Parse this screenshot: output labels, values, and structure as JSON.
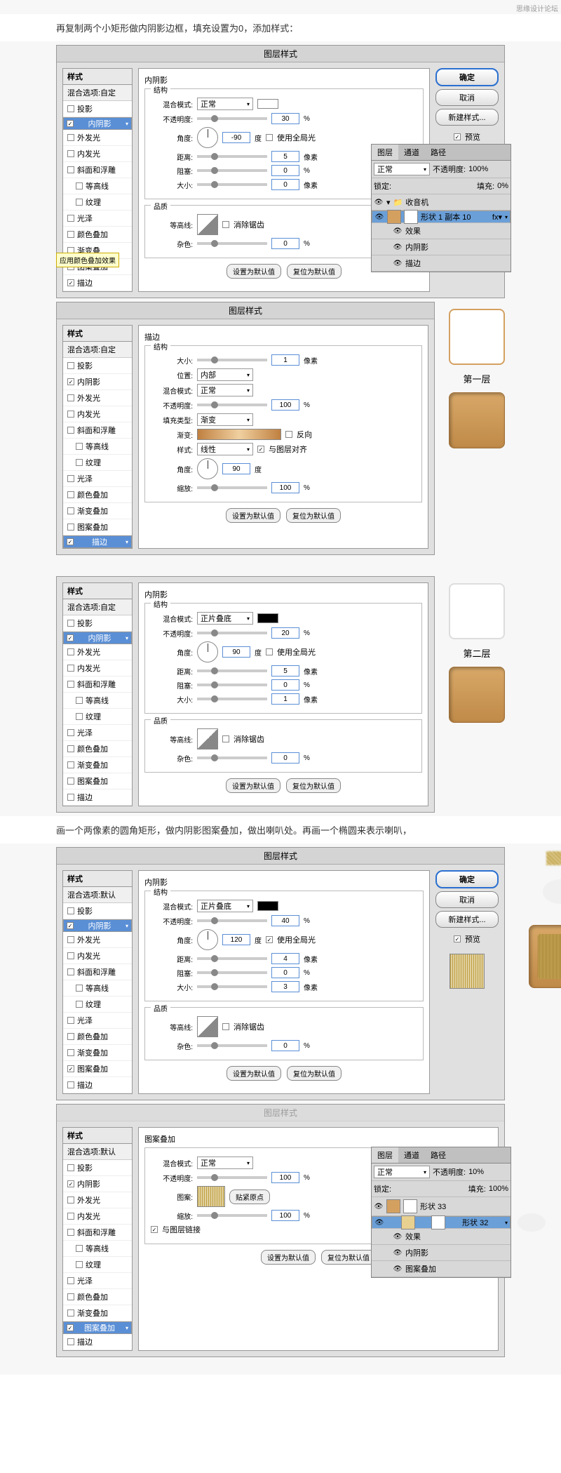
{
  "watermark": "思缘设计论坛",
  "caption1": "再复制两个小矩形做内阴影边框，填充设置为0，添加样式：",
  "caption2": "画一个两像素的圆角矩形，做内阴影图案叠加，做出喇叭处。再画一个椭圆来表示喇叭，",
  "dlg_title": "图层样式",
  "styles_header": "样式",
  "blend_custom": "混合选项:自定",
  "blend_default": "混合选项:默认",
  "style_items": [
    "投影",
    "内阴影",
    "外发光",
    "内发光",
    "斜面和浮雕",
    "等高线",
    "纹理",
    "光泽",
    "颜色叠加",
    "渐变叠加",
    "图案叠加",
    "描边"
  ],
  "tooltip1": "应用颜色叠加效果",
  "inner_shadow": {
    "title": "内阴影",
    "struct": "结构",
    "blend_mode": "混合模式:",
    "mode_normal": "正常",
    "mode_multiply": "正片叠底",
    "opacity": "不透明度:",
    "angle": "角度:",
    "deg": "度",
    "global": "使用全局光",
    "distance": "距离:",
    "choke": "阻塞:",
    "size": "大小:",
    "px": "像素",
    "quality": "品质",
    "contour": "等高线:",
    "anti": "消除锯齿",
    "noise": "杂色:"
  },
  "stroke": {
    "title": "描边",
    "struct": "结构",
    "size": "大小:",
    "px": "像素",
    "position": "位置:",
    "pos_inside": "内部",
    "blend_mode": "混合模式:",
    "mode_normal": "正常",
    "opacity": "不透明度:",
    "fill_type": "填充类型:",
    "ft_gradient": "渐变",
    "gradient": "渐变:",
    "reverse": "反向",
    "style": "样式:",
    "linear": "线性",
    "align": "与图层对齐",
    "angle": "角度:",
    "deg": "度",
    "scale": "缩放:"
  },
  "pattern": {
    "title": "图案叠加",
    "blend_mode": "混合模式:",
    "mode_normal": "正常",
    "opacity": "不透明度:",
    "pattern": "图案:",
    "snap": "贴紧原点",
    "scale": "缩放:",
    "link": "与图层链接"
  },
  "btns": {
    "ok": "确定",
    "cancel": "取消",
    "new": "新建样式...",
    "preview": "预览",
    "defaults": "设置为默认值",
    "reset": "复位为默认值"
  },
  "vals": {
    "p1_opacity": "30",
    "p1_angle": "-90",
    "p1_dist": "5",
    "p1_choke": "0",
    "p1_size": "0",
    "p1_noise": "0",
    "p2_size": "1",
    "p2_opacity": "100",
    "p2_angle": "90",
    "p2_scale": "100",
    "p3_opacity": "20",
    "p3_angle": "90",
    "p3_dist": "5",
    "p3_choke": "0",
    "p3_size": "1",
    "p3_noise": "0",
    "p4_opacity": "40",
    "p4_angle": "120",
    "p4_dist": "4",
    "p4_choke": "0",
    "p4_size": "3",
    "p4_noise": "0",
    "p5_opacity": "100",
    "p5_scale": "100"
  },
  "layers": {
    "tabs": [
      "图层",
      "通道",
      "路径"
    ],
    "mode": "正常",
    "opacity": "不透明度:",
    "opval": "100%",
    "opval2": "10%",
    "lock": "锁定:",
    "fill": "填充:",
    "fillval": "0%",
    "fillval2": "100%",
    "group": "收音机",
    "layer1": "形状 1 副本 10",
    "fx": "效果",
    "is": "内阴影",
    "shape33": "形状 33",
    "shape32": "形状 32",
    "pat": "图案叠加"
  },
  "preview_labels": {
    "l1": "第一层",
    "l2": "第二层"
  }
}
